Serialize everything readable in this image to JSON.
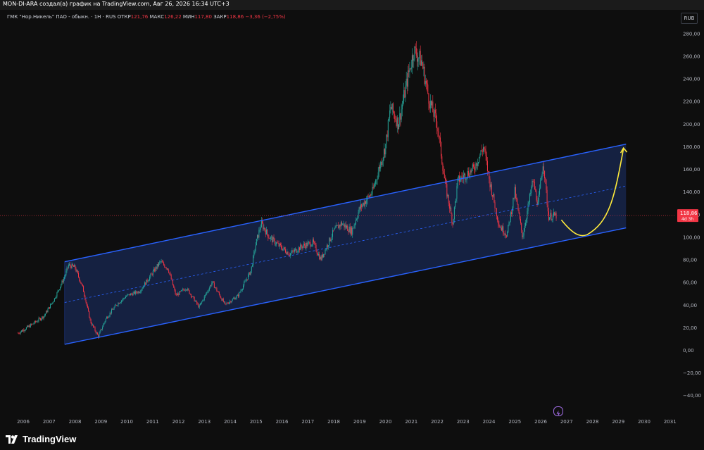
{
  "topbar": {
    "text": "MON-DI-ARA создал(а) график на TradingView.com, Авг 26, 2026 16:34 UTC+3"
  },
  "legend": {
    "symbol": "ГМК \"Нор.Никель\" ПАО - обыкн. · 1Н · RUS",
    "open_label": "ОТКР",
    "open": "121,76",
    "high_label": "МАКС",
    "high": "126,22",
    "low_label": "МИН",
    "low": "117,80",
    "close_label": "ЗАКР",
    "close": "118,86",
    "change": "−3,36 (−2,75%)"
  },
  "currency": "RUB",
  "price_tag": {
    "price": "118,86",
    "countdown": "4d 3h"
  },
  "logo": {
    "name": "TradingView"
  },
  "colors": {
    "up": "#26a69a",
    "down": "#f23645",
    "channel": "#2962ff",
    "arrow": "#ffeb3b",
    "background": "#0e0e0e"
  },
  "chart_data": {
    "type": "candlestick",
    "title": "",
    "xlabel": "",
    "ylabel": "",
    "x_ticks": [
      "2006",
      "2007",
      "2008",
      "2009",
      "2010",
      "2011",
      "2012",
      "2013",
      "2014",
      "2015",
      "2016",
      "2017",
      "2018",
      "2019",
      "2020",
      "2021",
      "2022",
      "2023",
      "2024",
      "2025",
      "2026",
      "2027",
      "2028",
      "2029",
      "2030",
      "2031"
    ],
    "y_ticks": [
      "280,00",
      "260,00",
      "240,00",
      "220,00",
      "200,00",
      "180,00",
      "160,00",
      "140,00",
      "120,00",
      "100,00",
      "80,00",
      "60,00",
      "40,00",
      "20,00",
      "0,00",
      "−20,00",
      "−40,00"
    ],
    "ylim": [
      -52,
      290
    ],
    "xlim": [
      2005.7,
      2031.6
    ],
    "grid": false,
    "series": [
      {
        "x": [
          2005.8,
          2006.3,
          2006.8,
          2007.2,
          2007.6,
          2007.75,
          2008.0,
          2008.3,
          2008.6,
          2008.9,
          2009.2,
          2009.6,
          2010.0,
          2010.5,
          2010.9,
          2011.3,
          2011.6,
          2011.9,
          2012.3,
          2012.8,
          2013.3,
          2013.8,
          2014.3,
          2014.8,
          2015.0,
          2015.2,
          2015.5,
          2015.9,
          2016.3,
          2016.8,
          2017.2,
          2017.5,
          2018.0,
          2018.3,
          2018.7,
          2019.0,
          2019.5,
          2020.0,
          2020.2,
          2020.5,
          2020.9,
          2021.1,
          2021.4,
          2021.7,
          2022.0,
          2022.3,
          2022.6,
          2022.8,
          2023.1,
          2023.4,
          2023.8,
          2024.0,
          2024.4,
          2024.7,
          2025.0,
          2025.3,
          2025.7,
          2025.9,
          2026.1,
          2026.3,
          2026.6
        ],
        "values": [
          15,
          22,
          30,
          45,
          65,
          75,
          73,
          55,
          25,
          12,
          28,
          40,
          48,
          52,
          65,
          78,
          72,
          48,
          55,
          38,
          60,
          40,
          48,
          70,
          95,
          112,
          100,
          92,
          85,
          92,
          95,
          80,
          105,
          112,
          105,
          125,
          140,
          180,
          215,
          200,
          245,
          265,
          255,
          220,
          200,
          148,
          112,
          150,
          155,
          160,
          180,
          152,
          110,
          102,
          140,
          100,
          150,
          128,
          168,
          118,
          118.86
        ]
      },
      {
        "name": "channel_upper",
        "x": [
          2007.6,
          2029.3
        ],
        "values": [
          78,
          182
        ]
      },
      {
        "name": "channel_mid",
        "x": [
          2007.6,
          2029.3
        ],
        "values": [
          42,
          145
        ]
      },
      {
        "name": "channel_lower",
        "x": [
          2007.6,
          2029.3
        ],
        "values": [
          5,
          108
        ]
      },
      {
        "name": "projection_arrow",
        "x": [
          2026.8,
          2027.8,
          2028.5,
          2029.0,
          2029.2
        ],
        "values": [
          115,
          102,
          112,
          145,
          178
        ]
      }
    ]
  }
}
